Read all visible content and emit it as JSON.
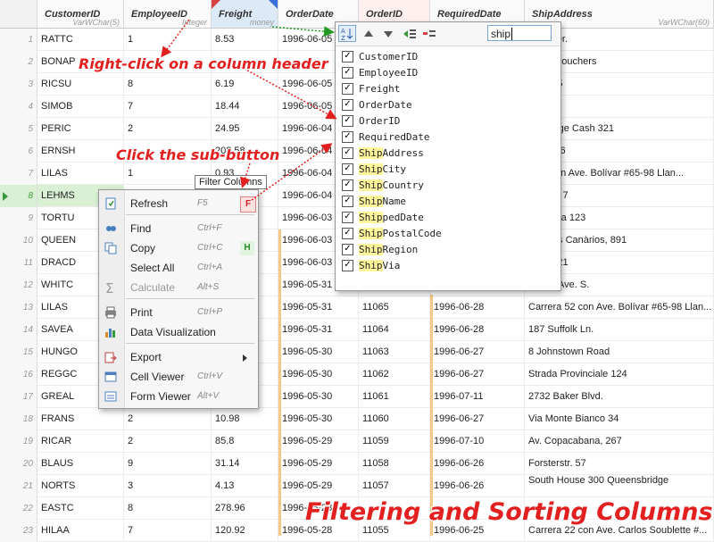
{
  "columns": [
    {
      "name": "CustomerID",
      "type": "VarWChar(5)"
    },
    {
      "name": "EmployeeID",
      "type": "Integer"
    },
    {
      "name": "Freight",
      "type": "money"
    },
    {
      "name": "OrderDate",
      "type": ""
    },
    {
      "name": "OrderID",
      "type": ""
    },
    {
      "name": "RequiredDate",
      "type": ""
    },
    {
      "name": "ShipAddress",
      "type": "VarWChar(60)"
    }
  ],
  "rows": [
    {
      "n": "1",
      "c": [
        "RATTC",
        "1",
        "8.53",
        "1996-06-05",
        "",
        "",
        "...lton Dr."
      ]
    },
    {
      "n": "2",
      "c": [
        "BONAP",
        "",
        "",
        "",
        "",
        "",
        "...des Bouchers"
      ]
    },
    {
      "n": "3",
      "c": [
        "RICSU",
        "8",
        "6.19",
        "1996-06-05",
        "",
        "",
        "...weg 5"
      ]
    },
    {
      "n": "4",
      "c": [
        "SIMOB",
        "7",
        "18.44",
        "1996-06-05",
        "",
        "",
        "...tet 34"
      ]
    },
    {
      "n": "5",
      "c": [
        "PERIC",
        "2",
        "24.95",
        "1996-06-04",
        "",
        "",
        "...r. Jorge Cash 321"
      ]
    },
    {
      "n": "6",
      "c": [
        "ERNSH",
        "",
        "208.58",
        "1996-06-04",
        "",
        "",
        "...asse 6"
      ]
    },
    {
      "n": "7",
      "c": [
        "LILAS",
        "1",
        "0.93",
        "1996-06-04",
        "",
        "",
        "...52 con Ave. Bolívar #65-98 Llan..."
      ]
    },
    {
      "n": "8",
      "c": [
        "LEHMS",
        "",
        "",
        "1996-06-04",
        "",
        "",
        "...nweg 7"
      ]
    },
    {
      "n": "9",
      "c": [
        "TORTU",
        "",
        "",
        "1996-06-03",
        "",
        "",
        "...Azteca 123"
      ]
    },
    {
      "n": "10",
      "c": [
        "QUEEN",
        "",
        "",
        "1996-06-03",
        "",
        "",
        "...la dos Canàrios, 891"
      ]
    },
    {
      "n": "11",
      "c": [
        "DRACD",
        "",
        "",
        "1996-06-03",
        "",
        "",
        "...weg 21"
      ]
    },
    {
      "n": "12",
      "c": [
        "WHITC",
        "",
        "",
        "1996-05-31",
        "",
        "",
        "...12th Ave. S."
      ]
    },
    {
      "n": "13",
      "c": [
        "LILAS",
        "",
        "",
        "1996-05-31",
        "11065",
        "1996-06-28",
        "Carrera 52 con Ave. Bolívar #65-98 Llan..."
      ]
    },
    {
      "n": "14",
      "c": [
        "SAVEA",
        "",
        "",
        "1996-05-31",
        "11064",
        "1996-06-28",
        "187 Suffolk Ln."
      ]
    },
    {
      "n": "15",
      "c": [
        "HUNGO",
        "",
        "",
        "1996-05-30",
        "11063",
        "1996-06-27",
        "8 Johnstown Road"
      ]
    },
    {
      "n": "16",
      "c": [
        "REGGC",
        "",
        "",
        "1996-05-30",
        "11062",
        "1996-06-27",
        "Strada Provinciale 124"
      ]
    },
    {
      "n": "17",
      "c": [
        "GREAL",
        "",
        "",
        "1996-05-30",
        "11061",
        "1996-07-11",
        "2732 Baker Blvd."
      ]
    },
    {
      "n": "18",
      "c": [
        "FRANS",
        "2",
        "10.98",
        "1996-05-30",
        "11060",
        "1996-06-27",
        "Via Monte Bianco 34"
      ]
    },
    {
      "n": "19",
      "c": [
        "RICAR",
        "2",
        "85.8",
        "1996-05-29",
        "11059",
        "1996-07-10",
        "Av. Copacabana, 267"
      ]
    },
    {
      "n": "20",
      "c": [
        "BLAUS",
        "9",
        "31.14",
        "1996-05-29",
        "11058",
        "1996-06-26",
        "Forsterstr. 57"
      ]
    },
    {
      "n": "21",
      "c": [
        "NORTS",
        "3",
        "4.13",
        "1996-05-29",
        "11057",
        "1996-06-26",
        "South House 300 Queensbridge"
      ]
    },
    {
      "n": "22",
      "c": [
        "EASTC",
        "8",
        "278.96",
        "1996-05-28",
        "",
        "",
        "..."
      ]
    },
    {
      "n": "23",
      "c": [
        "HILAA",
        "7",
        "120.92",
        "1996-05-28",
        "11055",
        "1996-06-25",
        "Carrera 22 con Ave. Carlos Soublette #..."
      ]
    }
  ],
  "column_menu": {
    "search_value": "ship",
    "items": [
      "CustomerID",
      "EmployeeID",
      "Freight",
      "OrderDate",
      "OrderID",
      "RequiredDate",
      "ShipAddress",
      "ShipCity",
      "ShipCountry",
      "ShipName",
      "ShippedDate",
      "ShipPostalCode",
      "ShipRegion",
      "ShipVia"
    ],
    "check": "✓"
  },
  "context_menu": {
    "items": [
      {
        "label": "Refresh",
        "shortcut": "F5",
        "badge": "F"
      },
      {
        "label": "Find",
        "shortcut": "Ctrl+F"
      },
      {
        "label": "Copy",
        "shortcut": "Ctrl+C",
        "badge": "H"
      },
      {
        "label": "Select All",
        "shortcut": "Ctrl+A"
      },
      {
        "label": "Calculate",
        "shortcut": "Alt+S"
      },
      {
        "label": "Print",
        "shortcut": "Ctrl+P"
      },
      {
        "label": "Data Visualization",
        "shortcut": ""
      },
      {
        "label": "Export",
        "shortcut": ""
      },
      {
        "label": "Cell Viewer",
        "shortcut": "Ctrl+V"
      },
      {
        "label": "Form Viewer",
        "shortcut": "Alt+V"
      }
    ]
  },
  "tooltip": "Filter Columns",
  "annotations": {
    "right_click": "Right-click on a column header",
    "sub_button": "Click the sub-button",
    "title": "Filtering and Sorting Columns"
  },
  "colors": {
    "accent": "#e32020",
    "selected_row": "#d9f0d4",
    "header_selected": "#dce9f7"
  }
}
